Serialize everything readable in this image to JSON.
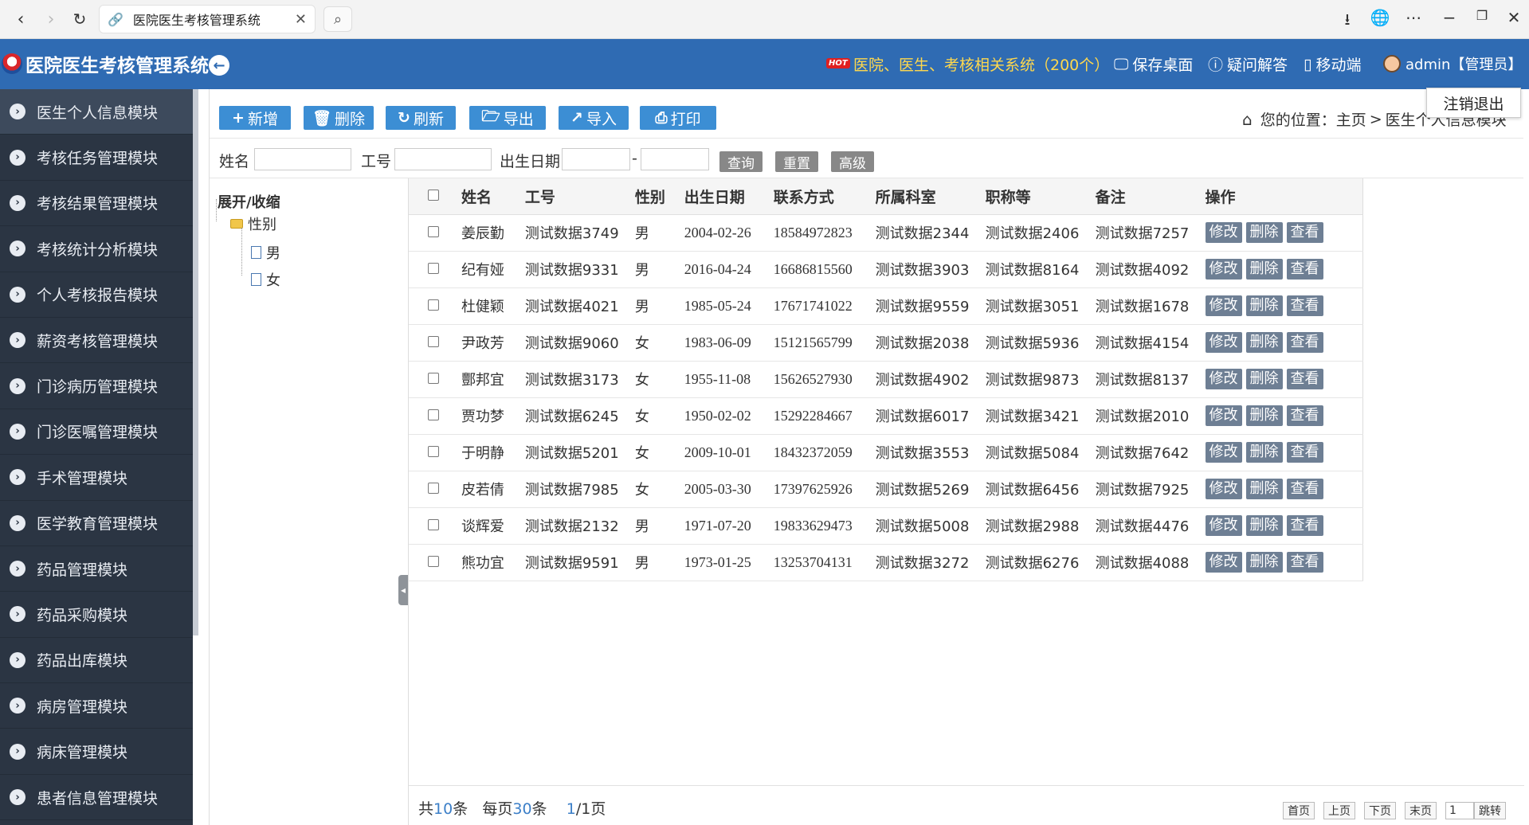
{
  "browser": {
    "tab_title": "医院医生考核管理系统"
  },
  "header": {
    "app_title": "医院医生考核管理系统",
    "hot_badge": "HOT",
    "hot_link": "医院、医生、考核相关系统（200个）",
    "save_desktop": "保存桌面",
    "faq": "疑问解答",
    "mobile": "移动端",
    "user": "admin【管理员】",
    "logout": "注销退出"
  },
  "sidebar": {
    "items": [
      {
        "label": "医生个人信息模块"
      },
      {
        "label": "考核任务管理模块"
      },
      {
        "label": "考核结果管理模块"
      },
      {
        "label": "考核统计分析模块"
      },
      {
        "label": "个人考核报告模块"
      },
      {
        "label": "薪资考核管理模块"
      },
      {
        "label": "门诊病历管理模块"
      },
      {
        "label": "门诊医嘱管理模块"
      },
      {
        "label": "手术管理模块"
      },
      {
        "label": "医学教育管理模块"
      },
      {
        "label": "药品管理模块"
      },
      {
        "label": "药品采购模块"
      },
      {
        "label": "药品出库模块"
      },
      {
        "label": "病房管理模块"
      },
      {
        "label": "病床管理模块"
      },
      {
        "label": "患者信息管理模块"
      }
    ]
  },
  "toolbar": {
    "add": "新增",
    "delete": "删除",
    "refresh": "刷新",
    "export": "导出",
    "import": "导入",
    "print": "打印"
  },
  "breadcrumb": {
    "prefix": "您的位置：",
    "home": "主页",
    "sep": ">",
    "current": "医生个人信息模块"
  },
  "filter": {
    "name_label": "姓名",
    "id_label": "工号",
    "birth_label": "出生日期",
    "dash": "-",
    "query": "查询",
    "reset": "重置",
    "advanced": "高级"
  },
  "tree": {
    "root": "展开/收缩",
    "folder": "性别",
    "leaves": [
      "男",
      "女"
    ]
  },
  "table": {
    "headers": [
      "姓名",
      "工号",
      "性别",
      "出生日期",
      "联系方式",
      "所属科室",
      "职称等",
      "备注",
      "操作"
    ],
    "ops": [
      "修改",
      "删除",
      "查看"
    ],
    "rows": [
      {
        "name": "姜辰勤",
        "id": "测试数据3749",
        "gender": "男",
        "birth": "2004-02-26",
        "phone": "18584972823",
        "dept": "测试数据2344",
        "title": "测试数据2406",
        "note": "测试数据7257"
      },
      {
        "name": "纪有娅",
        "id": "测试数据9331",
        "gender": "男",
        "birth": "2016-04-24",
        "phone": "16686815560",
        "dept": "测试数据3903",
        "title": "测试数据8164",
        "note": "测试数据4092"
      },
      {
        "name": "杜健颖",
        "id": "测试数据4021",
        "gender": "男",
        "birth": "1985-05-24",
        "phone": "17671741022",
        "dept": "测试数据9559",
        "title": "测试数据3051",
        "note": "测试数据1678"
      },
      {
        "name": "尹政芳",
        "id": "测试数据9060",
        "gender": "女",
        "birth": "1983-06-09",
        "phone": "15121565799",
        "dept": "测试数据2038",
        "title": "测试数据5936",
        "note": "测试数据4154"
      },
      {
        "name": "酆邦宜",
        "id": "测试数据3173",
        "gender": "女",
        "birth": "1955-11-08",
        "phone": "15626527930",
        "dept": "测试数据4902",
        "title": "测试数据9873",
        "note": "测试数据8137"
      },
      {
        "name": "贾功梦",
        "id": "测试数据6245",
        "gender": "女",
        "birth": "1950-02-02",
        "phone": "15292284667",
        "dept": "测试数据6017",
        "title": "测试数据3421",
        "note": "测试数据2010"
      },
      {
        "name": "于明静",
        "id": "测试数据5201",
        "gender": "女",
        "birth": "2009-10-01",
        "phone": "18432372059",
        "dept": "测试数据3553",
        "title": "测试数据5084",
        "note": "测试数据7642"
      },
      {
        "name": "皮若倩",
        "id": "测试数据7985",
        "gender": "女",
        "birth": "2005-03-30",
        "phone": "17397625926",
        "dept": "测试数据5269",
        "title": "测试数据6456",
        "note": "测试数据7925"
      },
      {
        "name": "谈辉爱",
        "id": "测试数据2132",
        "gender": "男",
        "birth": "1971-07-20",
        "phone": "19833629473",
        "dept": "测试数据5008",
        "title": "测试数据2988",
        "note": "测试数据4476"
      },
      {
        "name": "熊功宜",
        "id": "测试数据9591",
        "gender": "男",
        "birth": "1973-01-25",
        "phone": "13253704131",
        "dept": "测试数据3272",
        "title": "测试数据6276",
        "note": "测试数据4088"
      }
    ]
  },
  "pager": {
    "total_prefix": "共",
    "total": "10",
    "total_suffix": "条",
    "per_prefix": "每页",
    "per": "30",
    "per_suffix": "条",
    "page": "1",
    "pages": "/1页",
    "first": "首页",
    "prev": "上页",
    "next": "下页",
    "last": "末页",
    "goto_value": "1",
    "jump": "跳转"
  },
  "colors": {
    "header_bg": "#2f6bb3",
    "sidebar_bg": "#2b3543",
    "button_blue": "#3c8ed4",
    "op_button": "#6e7f94",
    "hot_link": "#ffd84d"
  }
}
